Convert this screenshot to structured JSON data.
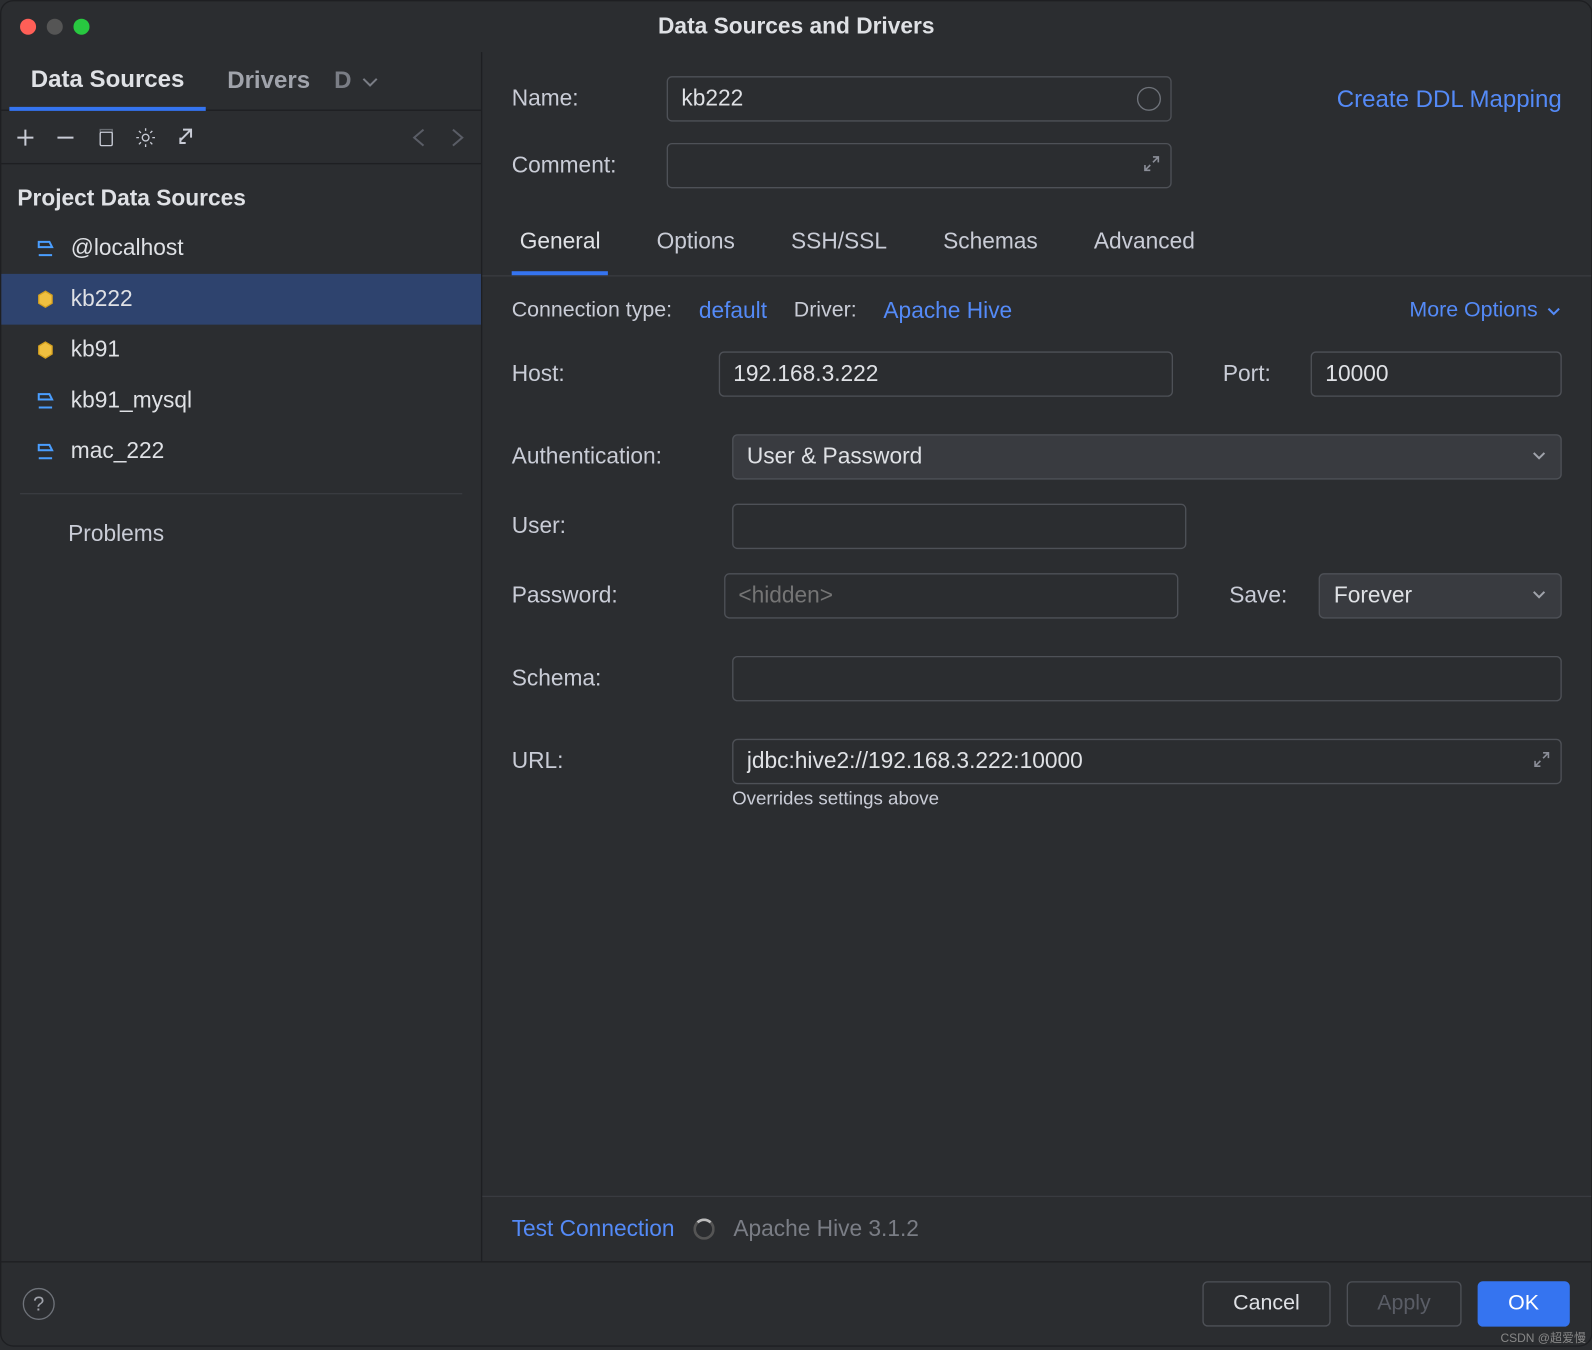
{
  "window_title": "Data Sources and Drivers",
  "sidebar": {
    "tabs": [
      "Data Sources",
      "Drivers",
      "D"
    ],
    "active_tab": 0,
    "section_label": "Project Data Sources",
    "items": [
      {
        "label": "@localhost",
        "icon": "db-blue"
      },
      {
        "label": "kb222",
        "icon": "db-hive",
        "selected": true
      },
      {
        "label": "kb91",
        "icon": "db-hive"
      },
      {
        "label": "kb91_mysql",
        "icon": "db-blue"
      },
      {
        "label": "mac_222",
        "icon": "db-blue"
      }
    ],
    "problems_label": "Problems"
  },
  "form": {
    "name_label": "Name:",
    "name_value": "kb222",
    "comment_label": "Comment:",
    "create_ddl_link": "Create DDL Mapping",
    "content_tabs": [
      "General",
      "Options",
      "SSH/SSL",
      "Schemas",
      "Advanced"
    ],
    "active_content_tab": 0,
    "connection_type_label": "Connection type:",
    "connection_type_value": "default",
    "driver_label": "Driver:",
    "driver_value": "Apache Hive",
    "more_options": "More Options",
    "host_label": "Host:",
    "host_value": "192.168.3.222",
    "port_label": "Port:",
    "port_value": "10000",
    "auth_label": "Authentication:",
    "auth_value": "User & Password",
    "user_label": "User:",
    "user_value": "",
    "password_label": "Password:",
    "password_placeholder": "<hidden>",
    "save_label": "Save:",
    "save_value": "Forever",
    "schema_label": "Schema:",
    "schema_value": "",
    "url_label": "URL:",
    "url_value": "jdbc:hive2://192.168.3.222:10000",
    "url_note": "Overrides settings above",
    "test_connection": "Test Connection",
    "driver_version": "Apache Hive 3.1.2"
  },
  "footer": {
    "cancel": "Cancel",
    "apply": "Apply",
    "ok": "OK"
  },
  "watermark": "CSDN @超爱慢"
}
